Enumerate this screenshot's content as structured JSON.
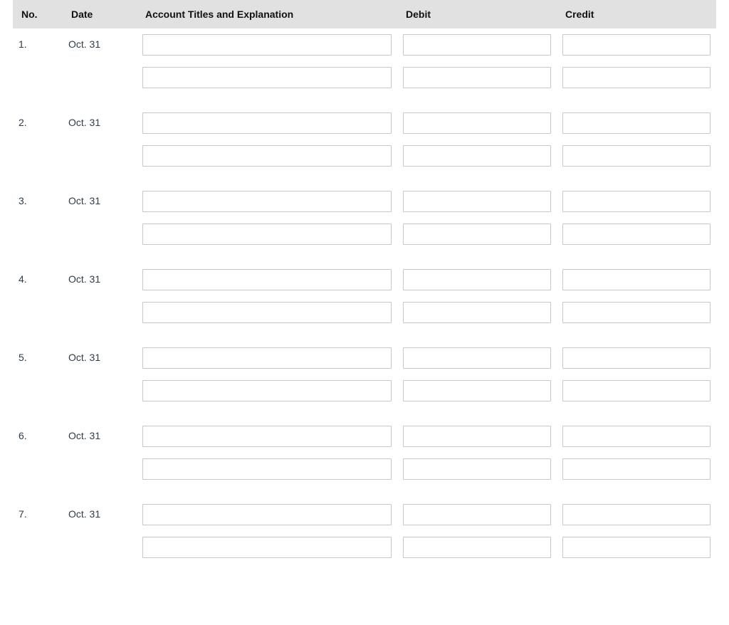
{
  "table": {
    "headers": {
      "no": "No.",
      "date": "Date",
      "account": "Account Titles and Explanation",
      "debit": "Debit",
      "credit": "Credit"
    },
    "entries": [
      {
        "no": "1.",
        "date": "Oct. 31",
        "lines": [
          {
            "account": "",
            "debit": "",
            "credit": ""
          },
          {
            "account": "",
            "debit": "",
            "credit": ""
          }
        ]
      },
      {
        "no": "2.",
        "date": "Oct. 31",
        "lines": [
          {
            "account": "",
            "debit": "",
            "credit": ""
          },
          {
            "account": "",
            "debit": "",
            "credit": ""
          }
        ]
      },
      {
        "no": "3.",
        "date": "Oct. 31",
        "lines": [
          {
            "account": "",
            "debit": "",
            "credit": ""
          },
          {
            "account": "",
            "debit": "",
            "credit": ""
          }
        ]
      },
      {
        "no": "4.",
        "date": "Oct. 31",
        "lines": [
          {
            "account": "",
            "debit": "",
            "credit": ""
          },
          {
            "account": "",
            "debit": "",
            "credit": ""
          }
        ]
      },
      {
        "no": "5.",
        "date": "Oct. 31",
        "lines": [
          {
            "account": "",
            "debit": "",
            "credit": ""
          },
          {
            "account": "",
            "debit": "",
            "credit": ""
          }
        ]
      },
      {
        "no": "6.",
        "date": "Oct. 31",
        "lines": [
          {
            "account": "",
            "debit": "",
            "credit": ""
          },
          {
            "account": "",
            "debit": "",
            "credit": ""
          }
        ]
      },
      {
        "no": "7.",
        "date": "Oct. 31",
        "lines": [
          {
            "account": "",
            "debit": "",
            "credit": ""
          },
          {
            "account": "",
            "debit": "",
            "credit": ""
          }
        ]
      }
    ]
  }
}
